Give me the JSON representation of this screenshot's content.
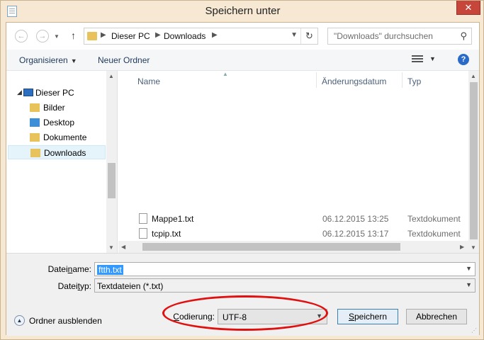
{
  "window": {
    "title": "Speichern unter",
    "close_label": "✕"
  },
  "address": {
    "crumbs": [
      "Dieser PC",
      "Downloads"
    ],
    "search_placeholder": "\"Downloads\" durchsuchen"
  },
  "toolbar": {
    "organize_label": "Organisieren",
    "new_folder_label": "Neuer Ordner",
    "help_label": "?"
  },
  "navpane": {
    "items": [
      {
        "label": "Dieser PC"
      },
      {
        "label": "Bilder"
      },
      {
        "label": "Desktop"
      },
      {
        "label": "Dokumente"
      },
      {
        "label": "Downloads"
      }
    ]
  },
  "filelist": {
    "columns": [
      "Name",
      "Änderungsdatum",
      "Typ"
    ],
    "rows": [
      {
        "name": "Mappe1.txt",
        "date": "06.12.2015 13:25",
        "type": "Textdokument"
      },
      {
        "name": "tcpip.txt",
        "date": "06.12.2015 13:17",
        "type": "Textdokument"
      }
    ]
  },
  "form": {
    "filename_label_pre": "Datei",
    "filename_label_u": "n",
    "filename_label_post": "ame:",
    "filename_value": "ftth.txt",
    "filetype_label_pre": "Datei",
    "filetype_label_u": "t",
    "filetype_label_post": "yp:",
    "filetype_value": "Textdateien (*.txt)",
    "encoding_label_u": "C",
    "encoding_label_post": "odierung:",
    "encoding_value": "UTF-8"
  },
  "buttons": {
    "hide_folders": "Ordner ausblenden",
    "save_u": "S",
    "save_post": "peichern",
    "cancel": "Abbrechen"
  }
}
